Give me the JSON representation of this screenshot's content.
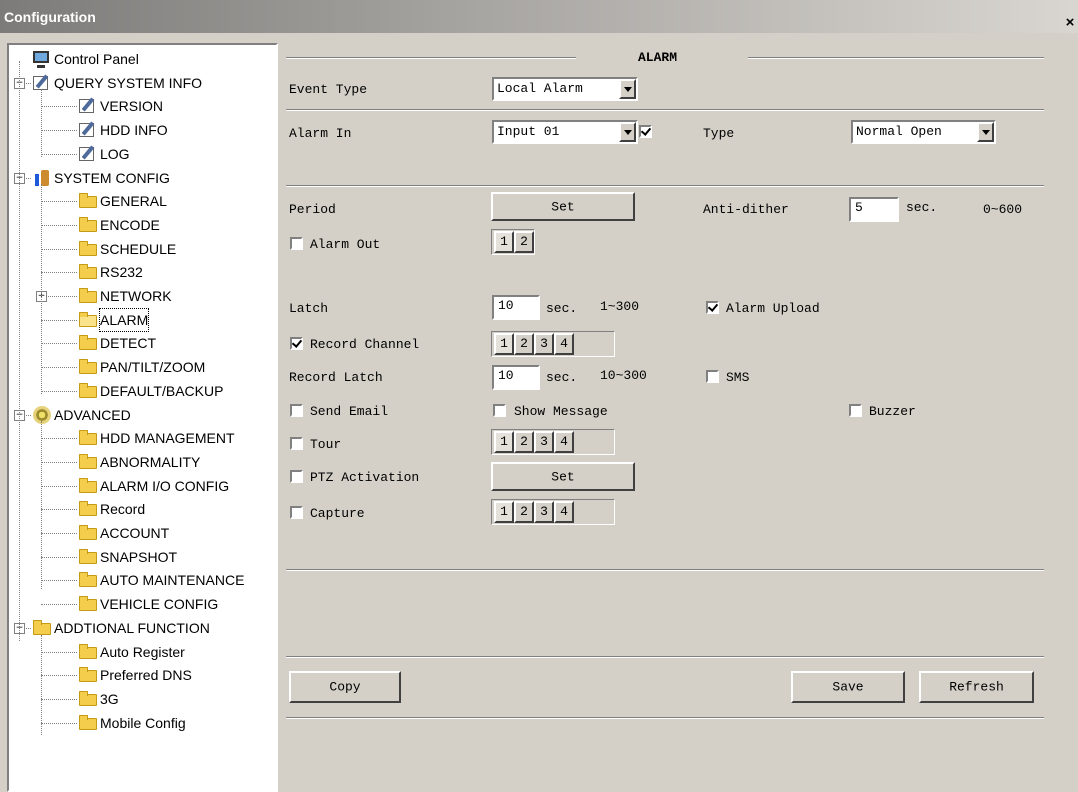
{
  "window": {
    "title": "Configuration",
    "close_label": "×"
  },
  "tree": [
    {
      "key": "control_panel",
      "label": "Control Panel",
      "icon": "monitor-icon"
    },
    {
      "key": "query",
      "label": "QUERY SYSTEM INFO",
      "icon": "edit-icon"
    },
    {
      "key": "version",
      "label": "VERSION",
      "icon": "edit-icon"
    },
    {
      "key": "hdd_info",
      "label": "HDD INFO",
      "icon": "edit-icon"
    },
    {
      "key": "log",
      "label": "LOG",
      "icon": "edit-icon"
    },
    {
      "key": "system_config",
      "label": "SYSTEM CONFIG",
      "icon": "tools-icon"
    },
    {
      "key": "general",
      "label": "GENERAL",
      "icon": "folder-icon"
    },
    {
      "key": "encode",
      "label": "ENCODE",
      "icon": "folder-icon"
    },
    {
      "key": "schedule",
      "label": "SCHEDULE",
      "icon": "folder-icon"
    },
    {
      "key": "rs232",
      "label": "RS232",
      "icon": "folder-icon"
    },
    {
      "key": "network",
      "label": "NETWORK",
      "icon": "folder-icon"
    },
    {
      "key": "alarm",
      "label": "ALARM",
      "icon": "open-folder-icon"
    },
    {
      "key": "detect",
      "label": "DETECT",
      "icon": "folder-icon"
    },
    {
      "key": "ptz",
      "label": "PAN/TILT/ZOOM",
      "icon": "folder-icon"
    },
    {
      "key": "default_backup",
      "label": "DEFAULT/BACKUP",
      "icon": "folder-icon"
    },
    {
      "key": "advanced",
      "label": "ADVANCED",
      "icon": "gears-icon"
    },
    {
      "key": "hdd_management",
      "label": "HDD MANAGEMENT",
      "icon": "folder-icon"
    },
    {
      "key": "abnormality",
      "label": "ABNORMALITY",
      "icon": "folder-icon"
    },
    {
      "key": "alarm_io",
      "label": "ALARM I/O CONFIG",
      "icon": "folder-icon"
    },
    {
      "key": "record",
      "label": "Record",
      "icon": "folder-icon"
    },
    {
      "key": "account",
      "label": "ACCOUNT",
      "icon": "folder-icon"
    },
    {
      "key": "snapshot",
      "label": "SNAPSHOT",
      "icon": "folder-icon"
    },
    {
      "key": "auto_maintenance",
      "label": "AUTO MAINTENANCE",
      "icon": "folder-icon"
    },
    {
      "key": "vehicle_config",
      "label": "VEHICLE CONFIG",
      "icon": "folder-icon"
    },
    {
      "key": "additional",
      "label": "ADDTIONAL FUNCTION",
      "icon": "folder-icon"
    },
    {
      "key": "auto_register",
      "label": "Auto Register",
      "icon": "folder-icon"
    },
    {
      "key": "preferred_dns",
      "label": "Preferred DNS",
      "icon": "folder-icon"
    },
    {
      "key": "3g",
      "label": "3G",
      "icon": "folder-icon"
    },
    {
      "key": "mobile_config",
      "label": "Mobile Config",
      "icon": "folder-icon"
    }
  ],
  "selected_item": "ALARM",
  "panel": {
    "section_title": "ALARM",
    "event_type": {
      "label": "Event Type",
      "value": "Local Alarm"
    },
    "alarm_in": {
      "label": "Alarm In",
      "value": "Input 01",
      "enabled": true
    },
    "type": {
      "label": "Type",
      "value": "Normal Open"
    },
    "period": {
      "label": "Period",
      "button": "Set"
    },
    "anti_dither": {
      "label": "Anti-dither",
      "value": "5",
      "unit": "sec.",
      "range": "0~600"
    },
    "alarm_out": {
      "label": "Alarm Out",
      "checked": false,
      "channels": [
        "1",
        "2"
      ]
    },
    "latch": {
      "label": "Latch",
      "value": "10",
      "unit": "sec.",
      "range": "1~300"
    },
    "alarm_upload": {
      "label": "Alarm Upload",
      "checked": true
    },
    "record_channel": {
      "label": "Record Channel",
      "checked": true,
      "channels": [
        "1",
        "2",
        "3",
        "4"
      ]
    },
    "record_latch": {
      "label": "Record Latch",
      "value": "10",
      "unit": "sec.",
      "range": "10~300"
    },
    "sms": {
      "label": "SMS",
      "checked": false
    },
    "send_email": {
      "label": "Send Email",
      "checked": false
    },
    "show_message": {
      "label": "Show Message",
      "checked": false
    },
    "buzzer": {
      "label": "Buzzer",
      "checked": false
    },
    "tour": {
      "label": "Tour",
      "checked": false,
      "channels": [
        "1",
        "2",
        "3",
        "4"
      ]
    },
    "ptz_activation": {
      "label": "PTZ Activation",
      "checked": false,
      "button": "Set"
    },
    "capture": {
      "label": "Capture",
      "checked": false,
      "channels": [
        "1",
        "2",
        "3",
        "4"
      ]
    },
    "buttons": {
      "copy": "Copy",
      "save": "Save",
      "refresh": "Refresh"
    }
  }
}
